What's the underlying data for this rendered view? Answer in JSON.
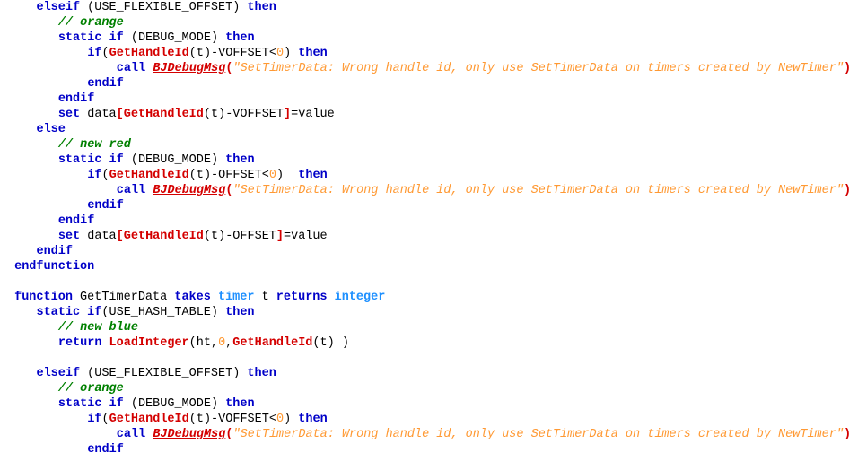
{
  "editor": {
    "name": "code-editor",
    "language": "JASS",
    "background": "#ffffff",
    "font_size_px": 13.5,
    "line_height_px": 17,
    "palette": {
      "keyword": "#0000c8",
      "type": "#1e90ff",
      "comment": "#008000",
      "function": "#d40000",
      "string": "#ff9933",
      "number": "#ff9933",
      "plain": "#000000",
      "bracket": "#d40000",
      "background": "#ffffff"
    }
  },
  "lines": [
    {
      "indent": 4,
      "tokens": [
        {
          "c": "t-kw",
          "t": "elseif"
        },
        {
          "c": "t-plain",
          "t": " (USE_FLEXIBLE_OFFSET) "
        },
        {
          "c": "t-kw",
          "t": "then"
        }
      ]
    },
    {
      "indent": 7,
      "tokens": [
        {
          "c": "t-comment",
          "t": "// orange"
        }
      ]
    },
    {
      "indent": 7,
      "tokens": [
        {
          "c": "t-kw",
          "t": "static if"
        },
        {
          "c": "t-plain",
          "t": " (DEBUG_MODE) "
        },
        {
          "c": "t-kw",
          "t": "then"
        }
      ]
    },
    {
      "indent": 11,
      "tokens": [
        {
          "c": "t-kw",
          "t": "if"
        },
        {
          "c": "t-plain",
          "t": "("
        },
        {
          "c": "t-fn",
          "t": "GetHandleId"
        },
        {
          "c": "t-plain",
          "t": "(t)-VOFFSET<"
        },
        {
          "c": "t-num",
          "t": "0"
        },
        {
          "c": "t-plain",
          "t": ") "
        },
        {
          "c": "t-kw",
          "t": "then"
        }
      ]
    },
    {
      "indent": 15,
      "tokens": [
        {
          "c": "t-kw",
          "t": "call"
        },
        {
          "c": "t-plain",
          "t": " "
        },
        {
          "c": "t-fn-u",
          "t": "BJDebugMsg"
        },
        {
          "c": "t-punc",
          "t": "("
        },
        {
          "c": "t-string",
          "t": "\"SetTimerData: Wrong handle id, only use SetTimerData on timers created by NewTimer\""
        },
        {
          "c": "t-punc",
          "t": ")"
        }
      ]
    },
    {
      "indent": 11,
      "tokens": [
        {
          "c": "t-kw",
          "t": "endif"
        }
      ]
    },
    {
      "indent": 7,
      "tokens": [
        {
          "c": "t-kw",
          "t": "endif"
        }
      ]
    },
    {
      "indent": 7,
      "tokens": [
        {
          "c": "t-kw",
          "t": "set"
        },
        {
          "c": "t-plain",
          "t": " data"
        },
        {
          "c": "t-punc",
          "t": "["
        },
        {
          "c": "t-fn",
          "t": "GetHandleId"
        },
        {
          "c": "t-plain",
          "t": "(t)-VOFFSET"
        },
        {
          "c": "t-punc",
          "t": "]"
        },
        {
          "c": "t-plain",
          "t": "=value"
        }
      ]
    },
    {
      "indent": 4,
      "tokens": [
        {
          "c": "t-kw",
          "t": "else"
        }
      ]
    },
    {
      "indent": 7,
      "tokens": [
        {
          "c": "t-comment",
          "t": "// new red"
        }
      ]
    },
    {
      "indent": 7,
      "tokens": [
        {
          "c": "t-kw",
          "t": "static if"
        },
        {
          "c": "t-plain",
          "t": " (DEBUG_MODE) "
        },
        {
          "c": "t-kw",
          "t": "then"
        }
      ]
    },
    {
      "indent": 11,
      "tokens": [
        {
          "c": "t-kw",
          "t": "if"
        },
        {
          "c": "t-plain",
          "t": "("
        },
        {
          "c": "t-fn",
          "t": "GetHandleId"
        },
        {
          "c": "t-plain",
          "t": "(t)-OFFSET<"
        },
        {
          "c": "t-num",
          "t": "0"
        },
        {
          "c": "t-plain",
          "t": ")  "
        },
        {
          "c": "t-kw",
          "t": "then"
        }
      ]
    },
    {
      "indent": 15,
      "tokens": [
        {
          "c": "t-kw",
          "t": "call"
        },
        {
          "c": "t-plain",
          "t": " "
        },
        {
          "c": "t-fn-u",
          "t": "BJDebugMsg"
        },
        {
          "c": "t-punc",
          "t": "("
        },
        {
          "c": "t-string",
          "t": "\"SetTimerData: Wrong handle id, only use SetTimerData on timers created by NewTimer\""
        },
        {
          "c": "t-punc",
          "t": ")"
        }
      ]
    },
    {
      "indent": 11,
      "tokens": [
        {
          "c": "t-kw",
          "t": "endif"
        }
      ]
    },
    {
      "indent": 7,
      "tokens": [
        {
          "c": "t-kw",
          "t": "endif"
        }
      ]
    },
    {
      "indent": 7,
      "tokens": [
        {
          "c": "t-kw",
          "t": "set"
        },
        {
          "c": "t-plain",
          "t": " data"
        },
        {
          "c": "t-punc",
          "t": "["
        },
        {
          "c": "t-fn",
          "t": "GetHandleId"
        },
        {
          "c": "t-plain",
          "t": "(t)-OFFSET"
        },
        {
          "c": "t-punc",
          "t": "]"
        },
        {
          "c": "t-plain",
          "t": "=value"
        }
      ]
    },
    {
      "indent": 4,
      "tokens": [
        {
          "c": "t-kw",
          "t": "endif"
        }
      ]
    },
    {
      "indent": 1,
      "tokens": [
        {
          "c": "t-kw",
          "t": "endfunction"
        }
      ]
    },
    {
      "indent": 0,
      "tokens": []
    },
    {
      "indent": 1,
      "tokens": [
        {
          "c": "t-kw",
          "t": "function"
        },
        {
          "c": "t-plain",
          "t": " GetTimerData "
        },
        {
          "c": "t-kw",
          "t": "takes"
        },
        {
          "c": "t-plain",
          "t": " "
        },
        {
          "c": "t-type",
          "t": "timer"
        },
        {
          "c": "t-plain",
          "t": " t "
        },
        {
          "c": "t-kw",
          "t": "returns"
        },
        {
          "c": "t-plain",
          "t": " "
        },
        {
          "c": "t-type",
          "t": "integer"
        }
      ]
    },
    {
      "indent": 4,
      "tokens": [
        {
          "c": "t-kw",
          "t": "static if"
        },
        {
          "c": "t-plain",
          "t": "(USE_HASH_TABLE) "
        },
        {
          "c": "t-kw",
          "t": "then"
        }
      ]
    },
    {
      "indent": 7,
      "tokens": [
        {
          "c": "t-comment",
          "t": "// new blue"
        }
      ]
    },
    {
      "indent": 7,
      "tokens": [
        {
          "c": "t-kw",
          "t": "return"
        },
        {
          "c": "t-plain",
          "t": " "
        },
        {
          "c": "t-fn",
          "t": "LoadInteger"
        },
        {
          "c": "t-plain",
          "t": "(ht,"
        },
        {
          "c": "t-num",
          "t": "0"
        },
        {
          "c": "t-plain",
          "t": ","
        },
        {
          "c": "t-fn",
          "t": "GetHandleId"
        },
        {
          "c": "t-plain",
          "t": "(t) )"
        }
      ]
    },
    {
      "indent": 0,
      "tokens": []
    },
    {
      "indent": 4,
      "tokens": [
        {
          "c": "t-kw",
          "t": "elseif"
        },
        {
          "c": "t-plain",
          "t": " (USE_FLEXIBLE_OFFSET) "
        },
        {
          "c": "t-kw",
          "t": "then"
        }
      ]
    },
    {
      "indent": 7,
      "tokens": [
        {
          "c": "t-comment",
          "t": "// orange"
        }
      ]
    },
    {
      "indent": 7,
      "tokens": [
        {
          "c": "t-kw",
          "t": "static if"
        },
        {
          "c": "t-plain",
          "t": " (DEBUG_MODE) "
        },
        {
          "c": "t-kw",
          "t": "then"
        }
      ]
    },
    {
      "indent": 11,
      "tokens": [
        {
          "c": "t-kw",
          "t": "if"
        },
        {
          "c": "t-plain",
          "t": "("
        },
        {
          "c": "t-fn",
          "t": "GetHandleId"
        },
        {
          "c": "t-plain",
          "t": "(t)-VOFFSET<"
        },
        {
          "c": "t-num",
          "t": "0"
        },
        {
          "c": "t-plain",
          "t": ") "
        },
        {
          "c": "t-kw",
          "t": "then"
        }
      ]
    },
    {
      "indent": 15,
      "tokens": [
        {
          "c": "t-kw",
          "t": "call"
        },
        {
          "c": "t-plain",
          "t": " "
        },
        {
          "c": "t-fn-u",
          "t": "BJDebugMsg"
        },
        {
          "c": "t-punc",
          "t": "("
        },
        {
          "c": "t-string",
          "t": "\"SetTimerData: Wrong handle id, only use SetTimerData on timers created by NewTimer\""
        },
        {
          "c": "t-punc",
          "t": ")"
        }
      ]
    },
    {
      "indent": 11,
      "tokens": [
        {
          "c": "t-kw",
          "t": "endif"
        }
      ]
    }
  ]
}
